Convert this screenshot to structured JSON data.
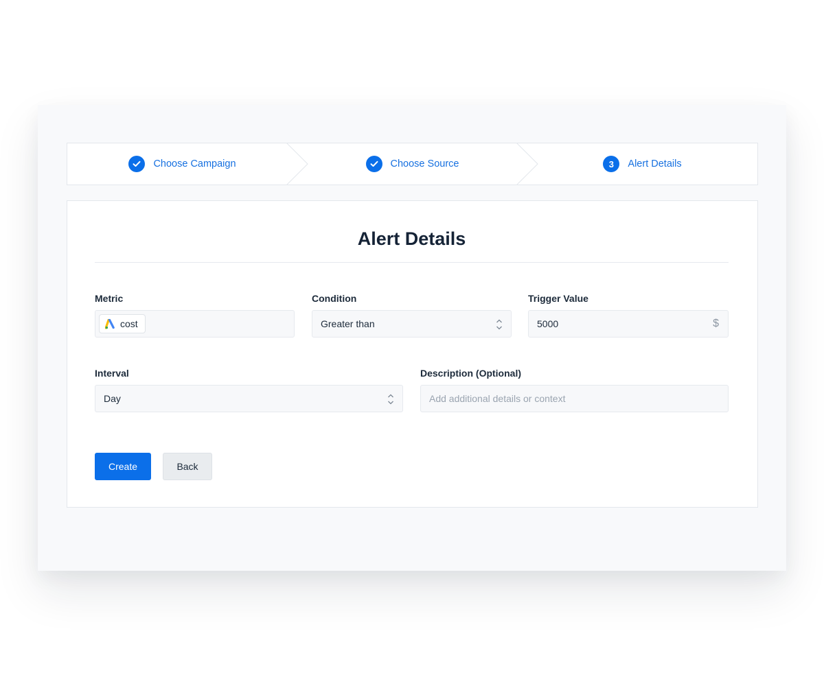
{
  "steps": [
    {
      "label": "Choose Campaign",
      "status": "done"
    },
    {
      "label": "Choose Source",
      "status": "done"
    },
    {
      "label": "Alert Details",
      "number": "3",
      "status": "current"
    }
  ],
  "form": {
    "title": "Alert Details",
    "metric": {
      "label": "Metric",
      "chip_text": "cost",
      "chip_icon": "google-ads-icon"
    },
    "condition": {
      "label": "Condition",
      "value": "Greater than"
    },
    "trigger": {
      "label": "Trigger Value",
      "value": "5000",
      "suffix": "$"
    },
    "interval": {
      "label": "Interval",
      "value": "Day"
    },
    "description": {
      "label": "Description (Optional)",
      "placeholder": "Add additional details or context"
    }
  },
  "buttons": {
    "create": "Create",
    "back": "Back"
  },
  "colors": {
    "accent": "#0b6fe9",
    "text": "#152336",
    "border": "#e3e7ec"
  }
}
